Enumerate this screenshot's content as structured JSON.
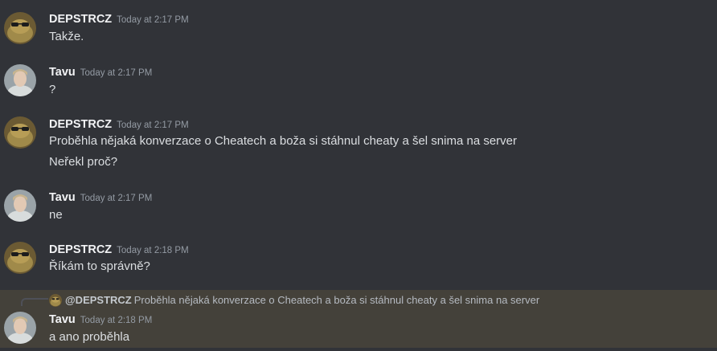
{
  "messages": [
    {
      "author": "DEPSTRCZ",
      "timestamp": "Today at 2:17 PM",
      "avatar_icon": "frog-with-sunglasses-avatar",
      "lines": [
        "Takže."
      ]
    },
    {
      "author": "Tavu",
      "timestamp": "Today at 2:17 PM",
      "avatar_icon": "person-photo-avatar",
      "lines": [
        "?"
      ]
    },
    {
      "author": "DEPSTRCZ",
      "timestamp": "Today at 2:17 PM",
      "avatar_icon": "frog-with-sunglasses-avatar",
      "lines": [
        "Proběhla nějaká konverzace o Cheatech a boža si stáhnul cheaty a šel snima na server",
        "Neřekl proč?"
      ]
    },
    {
      "author": "Tavu",
      "timestamp": "Today at 2:17 PM",
      "avatar_icon": "person-photo-avatar",
      "lines": [
        "ne"
      ]
    },
    {
      "author": "DEPSTRCZ",
      "timestamp": "Today at 2:18 PM",
      "avatar_icon": "frog-with-sunglasses-avatar",
      "lines": [
        "Říkám to správně?"
      ]
    },
    {
      "author": "Tavu",
      "timestamp": "Today at 2:18 PM",
      "avatar_icon": "person-photo-avatar",
      "lines": [
        "a ano proběhla"
      ],
      "reply_to": {
        "mention": "@DEPSTRCZ",
        "text": "Proběhla nějaká konverzace o Cheatech a boža si stáhnul cheaty a šel snima na server"
      }
    }
  ],
  "colors": {
    "background": "#313338",
    "highlight": "#44413a",
    "author": "#f2f3f5",
    "timestamp": "#949ba4",
    "text": "#dbdee1"
  }
}
